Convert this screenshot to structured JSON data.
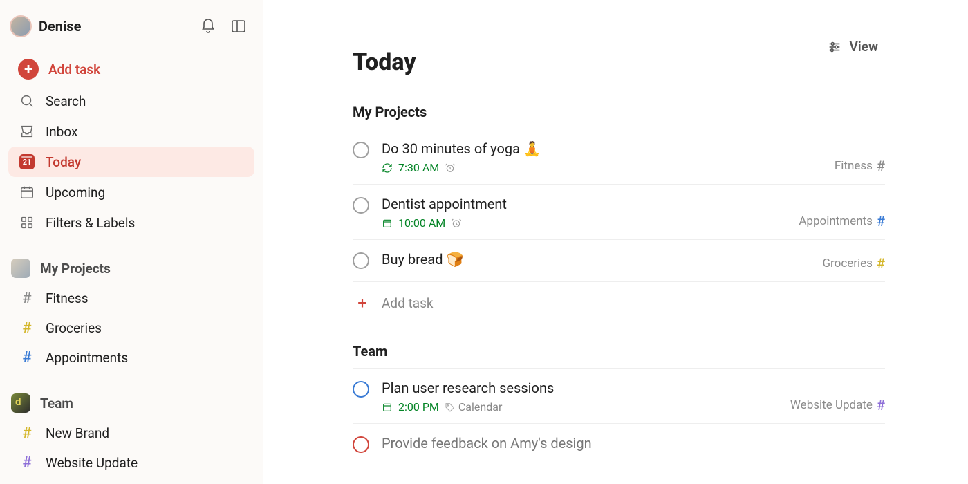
{
  "user": {
    "name": "Denise"
  },
  "sidebar": {
    "add_label": "Add task",
    "items": [
      {
        "key": "search",
        "label": "Search"
      },
      {
        "key": "inbox",
        "label": "Inbox"
      },
      {
        "key": "today",
        "label": "Today",
        "badge": "21"
      },
      {
        "key": "upcoming",
        "label": "Upcoming"
      },
      {
        "key": "filters",
        "label": "Filters & Labels"
      }
    ],
    "personal": {
      "title": "My Projects",
      "projects": [
        {
          "label": "Fitness",
          "color": "grey"
        },
        {
          "label": "Groceries",
          "color": "yellow"
        },
        {
          "label": "Appointments",
          "color": "blue"
        }
      ]
    },
    "team": {
      "title": "Team",
      "projects": [
        {
          "label": "New Brand",
          "color": "yellow"
        },
        {
          "label": "Website Update",
          "color": "purple"
        }
      ]
    }
  },
  "header": {
    "title": "Today",
    "view_label": "View"
  },
  "groups": [
    {
      "title": "My Projects",
      "tasks": [
        {
          "title": "Do 30 minutes of yoga 🧘",
          "time": "7:30 AM",
          "meta_kind": "recurring",
          "alarm": true,
          "project": "Fitness",
          "project_color": "grey",
          "priority": "none"
        },
        {
          "title": "Dentist appointment",
          "time": "10:00 AM",
          "meta_kind": "date",
          "alarm": true,
          "project": "Appointments",
          "project_color": "blue",
          "priority": "none"
        },
        {
          "title": "Buy bread 🍞",
          "time": "",
          "meta_kind": "",
          "alarm": false,
          "project": "Groceries",
          "project_color": "yellow",
          "priority": "none"
        }
      ],
      "add_label": "Add task"
    },
    {
      "title": "Team",
      "tasks": [
        {
          "title": "Plan user research sessions",
          "time": "2:00 PM",
          "meta_kind": "date",
          "alarm": false,
          "calendar_tag": "Calendar",
          "project": "Website Update",
          "project_color": "purple",
          "priority": "blue"
        },
        {
          "title": "Provide feedback on Amy's design",
          "time": "",
          "meta_kind": "",
          "alarm": false,
          "project": "",
          "project_color": "",
          "priority": "red"
        }
      ]
    }
  ]
}
